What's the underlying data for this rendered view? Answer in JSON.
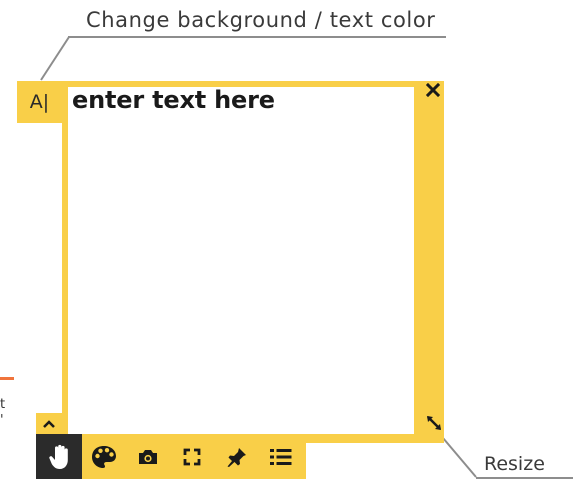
{
  "callouts": {
    "color_label": "Change background / text color",
    "resize_label": "Resize"
  },
  "partial_text": "t\n'",
  "note": {
    "text": "enter text here",
    "color_button_label": "A|",
    "background_color": "#f9cf48",
    "text_area_color": "#ffffff"
  },
  "icons": {
    "close": "close-icon",
    "resize": "resize-diagonal-icon",
    "collapse": "chevron-up-icon",
    "toolbar": [
      "hand-icon",
      "palette-icon",
      "camera-icon",
      "fullscreen-icon",
      "pin-icon",
      "list-icon"
    ]
  }
}
